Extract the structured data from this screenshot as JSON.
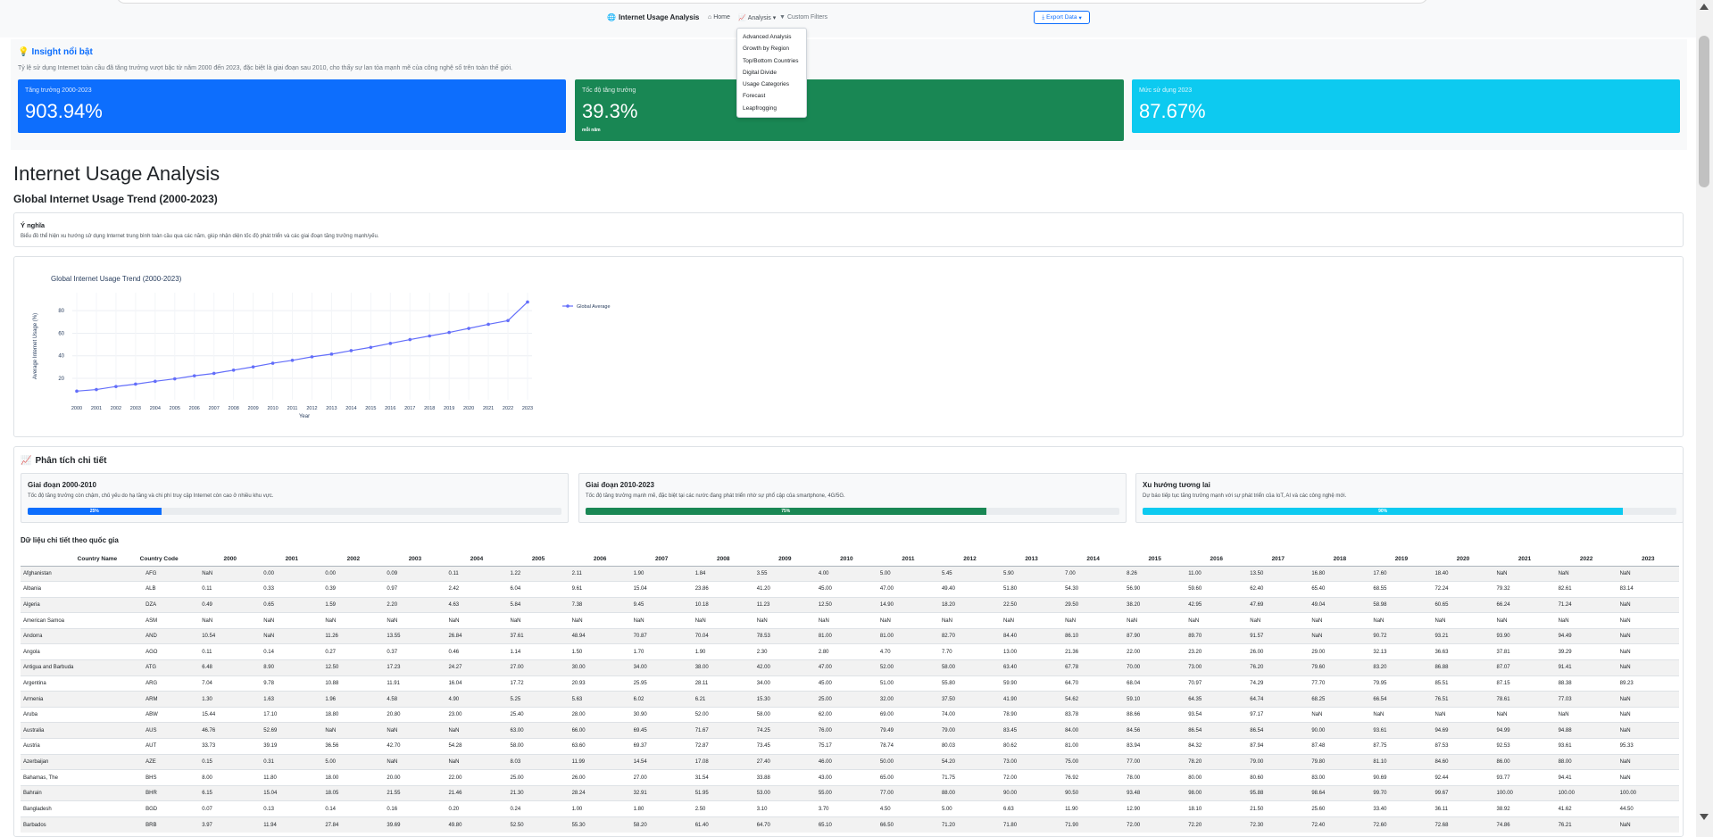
{
  "navbar": {
    "brand": "Internet Usage Analysis",
    "home": "Home",
    "analysis": "Analysis",
    "filters": "Custom Filters",
    "export": "Export Data",
    "dropdown": [
      "Advanced Analysis",
      "Growth by Region",
      "Top/Bottom Countries",
      "Digital Divide",
      "Usage Categories",
      "Forecast",
      "Leapfrogging"
    ]
  },
  "insight": {
    "title": "Insight nổi bật",
    "description": "Tỷ lệ sử dụng Internet toàn cầu đã tăng trưởng vượt bậc từ năm 2000 đến 2023, đặc biệt là giai đoạn sau 2010, cho thấy sự lan tỏa mạnh mẽ của công nghệ số trên toàn thế giới.",
    "cards": [
      {
        "label": "Tăng trưởng 2000-2023",
        "value": "903.94%",
        "sub": ""
      },
      {
        "label": "Tốc độ tăng trưởng",
        "value": "39.3%",
        "sub": "mỗi năm"
      },
      {
        "label": "Mức sử dụng 2023",
        "value": "87.67%",
        "sub": ""
      }
    ],
    "colors": {
      "blue": "#0d6efd",
      "green": "#198754",
      "cyan": "#0dcaf0"
    }
  },
  "main": {
    "title": "Internet Usage Analysis",
    "subtitle": "Global Internet Usage Trend (2000-2023)",
    "meaning_title": "Ý nghĩa",
    "meaning_text": "Biểu đồ thể hiện xu hướng sử dụng Internet trung bình toàn cầu qua các năm, giúp nhận diện tốc độ phát triển và các giai đoạn tăng trưởng mạnh/yếu."
  },
  "chart_data": {
    "type": "line",
    "title": "Global Internet Usage Trend (2000-2023)",
    "xlabel": "Year",
    "ylabel": "Average Internet Usage (%)",
    "x": [
      2000,
      2001,
      2002,
      2003,
      2004,
      2005,
      2006,
      2007,
      2008,
      2009,
      2010,
      2011,
      2012,
      2013,
      2014,
      2015,
      2016,
      2017,
      2018,
      2019,
      2020,
      2021,
      2022,
      2023
    ],
    "series": [
      {
        "name": "Global Average",
        "values": [
          8.7,
          10.1,
          12.8,
          14.9,
          17.4,
          19.6,
          22.3,
          24.4,
          27.3,
          30.2,
          33.4,
          36.0,
          39.1,
          41.5,
          44.6,
          47.5,
          51.0,
          54.4,
          57.6,
          60.7,
          64.3,
          67.9,
          71.2,
          87.67
        ],
        "color": "#636efa"
      }
    ],
    "yticks": [
      20,
      40,
      60,
      80
    ],
    "ylim": [
      5,
      92
    ],
    "legend": "top-right",
    "grid": true
  },
  "detail": {
    "title": "Phân tích chi tiết",
    "phases": [
      {
        "title": "Giai đoạn 2000-2010",
        "text": "Tốc độ tăng trưởng còn chậm, chủ yếu do hạ tầng và chi phí truy cập Internet còn cao ở nhiều khu vực.",
        "percent": 25,
        "label": "25%",
        "color": "#0d6efd"
      },
      {
        "title": "Giai đoạn 2010-2023",
        "text": "Tốc độ tăng trưởng mạnh mẽ, đặc biệt tại các nước đang phát triển nhờ sự phổ cập của smartphone, 4G/5G.",
        "percent": 75,
        "label": "75%",
        "color": "#198754"
      },
      {
        "title": "Xu hướng tương lai",
        "text": "Dự báo tiếp tục tăng trưởng mạnh với sự phát triển của IoT, AI và các công nghệ mới.",
        "percent": 90,
        "label": "90%",
        "color": "#0dcaf0"
      }
    ],
    "table_title": "Dữ liệu chi tiết theo quốc gia",
    "table": {
      "headers": [
        "Country Name",
        "Country Code",
        "2000",
        "2001",
        "2002",
        "2003",
        "2004",
        "2005",
        "2006",
        "2007",
        "2008",
        "2009",
        "2010",
        "2011",
        "2012",
        "2013",
        "2014",
        "2015",
        "2016",
        "2017",
        "2018",
        "2019",
        "2020",
        "2021",
        "2022",
        "2023"
      ],
      "rows": [
        [
          "Afghanistan",
          "AFG",
          "NaN",
          "0.00",
          "0.00",
          "0.09",
          "0.11",
          "1.22",
          "2.11",
          "1.90",
          "1.84",
          "3.55",
          "4.00",
          "5.00",
          "5.45",
          "5.90",
          "7.00",
          "8.26",
          "11.00",
          "13.50",
          "16.80",
          "17.60",
          "18.40",
          "NaN",
          "NaN",
          "NaN"
        ],
        [
          "Albania",
          "ALB",
          "0.11",
          "0.33",
          "0.39",
          "0.97",
          "2.42",
          "6.04",
          "9.61",
          "15.04",
          "23.86",
          "41.20",
          "45.00",
          "47.00",
          "49.40",
          "51.80",
          "54.30",
          "56.90",
          "59.60",
          "62.40",
          "65.40",
          "68.55",
          "72.24",
          "79.32",
          "82.61",
          "83.14"
        ],
        [
          "Algeria",
          "DZA",
          "0.49",
          "0.65",
          "1.59",
          "2.20",
          "4.63",
          "5.84",
          "7.38",
          "9.45",
          "10.18",
          "11.23",
          "12.50",
          "14.90",
          "18.20",
          "22.50",
          "29.50",
          "38.20",
          "42.95",
          "47.69",
          "49.04",
          "58.98",
          "60.65",
          "66.24",
          "71.24",
          "NaN"
        ],
        [
          "American Samoa",
          "ASM",
          "NaN",
          "NaN",
          "NaN",
          "NaN",
          "NaN",
          "NaN",
          "NaN",
          "NaN",
          "NaN",
          "NaN",
          "NaN",
          "NaN",
          "NaN",
          "NaN",
          "NaN",
          "NaN",
          "NaN",
          "NaN",
          "NaN",
          "NaN",
          "NaN",
          "NaN",
          "NaN",
          "NaN"
        ],
        [
          "Andorra",
          "AND",
          "10.54",
          "NaN",
          "11.26",
          "13.55",
          "26.84",
          "37.61",
          "48.94",
          "70.87",
          "70.04",
          "78.53",
          "81.00",
          "81.00",
          "82.70",
          "84.40",
          "86.10",
          "87.90",
          "89.70",
          "91.57",
          "NaN",
          "90.72",
          "93.21",
          "93.90",
          "94.49",
          "NaN"
        ],
        [
          "Angola",
          "AGO",
          "0.11",
          "0.14",
          "0.27",
          "0.37",
          "0.46",
          "1.14",
          "1.50",
          "1.70",
          "1.90",
          "2.30",
          "2.80",
          "4.70",
          "7.70",
          "13.00",
          "21.36",
          "22.00",
          "23.20",
          "26.00",
          "29.00",
          "32.13",
          "36.63",
          "37.81",
          "39.29",
          "NaN"
        ],
        [
          "Antigua and Barbuda",
          "ATG",
          "6.48",
          "8.90",
          "12.50",
          "17.23",
          "24.27",
          "27.00",
          "30.00",
          "34.00",
          "38.00",
          "42.00",
          "47.00",
          "52.00",
          "58.00",
          "63.40",
          "67.78",
          "70.00",
          "73.00",
          "76.20",
          "79.60",
          "83.20",
          "86.88",
          "87.07",
          "91.41",
          "NaN"
        ],
        [
          "Argentina",
          "ARG",
          "7.04",
          "9.78",
          "10.88",
          "11.91",
          "16.04",
          "17.72",
          "20.93",
          "25.95",
          "28.11",
          "34.00",
          "45.00",
          "51.00",
          "55.80",
          "59.90",
          "64.70",
          "68.04",
          "70.97",
          "74.29",
          "77.70",
          "79.95",
          "85.51",
          "87.15",
          "88.38",
          "89.23"
        ],
        [
          "Armenia",
          "ARM",
          "1.30",
          "1.63",
          "1.96",
          "4.58",
          "4.90",
          "5.25",
          "5.63",
          "6.02",
          "6.21",
          "15.30",
          "25.00",
          "32.00",
          "37.50",
          "41.90",
          "54.62",
          "59.10",
          "64.35",
          "64.74",
          "68.25",
          "66.54",
          "76.51",
          "78.61",
          "77.03",
          "NaN"
        ],
        [
          "Aruba",
          "ABW",
          "15.44",
          "17.10",
          "18.80",
          "20.80",
          "23.00",
          "25.40",
          "28.00",
          "30.90",
          "52.00",
          "58.00",
          "62.00",
          "69.00",
          "74.00",
          "78.90",
          "83.78",
          "88.66",
          "93.54",
          "97.17",
          "NaN",
          "NaN",
          "NaN",
          "NaN",
          "NaN",
          "NaN"
        ],
        [
          "Australia",
          "AUS",
          "46.76",
          "52.69",
          "NaN",
          "NaN",
          "NaN",
          "63.00",
          "66.00",
          "69.45",
          "71.67",
          "74.25",
          "76.00",
          "79.49",
          "79.00",
          "83.45",
          "84.00",
          "84.56",
          "86.54",
          "86.54",
          "90.00",
          "93.61",
          "94.69",
          "94.99",
          "94.88",
          "NaN"
        ],
        [
          "Austria",
          "AUT",
          "33.73",
          "39.19",
          "36.56",
          "42.70",
          "54.28",
          "58.00",
          "63.60",
          "69.37",
          "72.87",
          "73.45",
          "75.17",
          "78.74",
          "80.03",
          "80.62",
          "81.00",
          "83.94",
          "84.32",
          "87.94",
          "87.48",
          "87.75",
          "87.53",
          "92.53",
          "93.61",
          "95.33"
        ],
        [
          "Azerbaijan",
          "AZE",
          "0.15",
          "0.31",
          "5.00",
          "NaN",
          "NaN",
          "8.03",
          "11.99",
          "14.54",
          "17.08",
          "27.40",
          "46.00",
          "50.00",
          "54.20",
          "73.00",
          "75.00",
          "77.00",
          "78.20",
          "79.00",
          "79.80",
          "81.10",
          "84.60",
          "86.00",
          "88.00",
          "NaN"
        ],
        [
          "Bahamas, The",
          "BHS",
          "8.00",
          "11.80",
          "18.00",
          "20.00",
          "22.00",
          "25.00",
          "26.00",
          "27.00",
          "31.54",
          "33.88",
          "43.00",
          "65.00",
          "71.75",
          "72.00",
          "76.92",
          "78.00",
          "80.00",
          "80.60",
          "83.00",
          "90.69",
          "92.44",
          "93.77",
          "94.41",
          "NaN"
        ],
        [
          "Bahrain",
          "BHR",
          "6.15",
          "15.04",
          "18.05",
          "21.55",
          "21.46",
          "21.30",
          "28.24",
          "32.91",
          "51.95",
          "53.00",
          "55.00",
          "77.00",
          "88.00",
          "90.00",
          "90.50",
          "93.48",
          "98.00",
          "95.88",
          "98.64",
          "99.70",
          "99.67",
          "100.00",
          "100.00",
          "100.00"
        ],
        [
          "Bangladesh",
          "BGD",
          "0.07",
          "0.13",
          "0.14",
          "0.16",
          "0.20",
          "0.24",
          "1.00",
          "1.80",
          "2.50",
          "3.10",
          "3.70",
          "4.50",
          "5.00",
          "6.63",
          "11.90",
          "12.90",
          "18.10",
          "21.50",
          "25.60",
          "33.40",
          "36.11",
          "38.92",
          "41.62",
          "44.50"
        ],
        [
          "Barbados",
          "BRB",
          "3.97",
          "11.94",
          "27.84",
          "39.69",
          "49.80",
          "52.50",
          "55.30",
          "58.20",
          "61.40",
          "64.70",
          "65.10",
          "66.50",
          "71.20",
          "71.80",
          "71.90",
          "72.00",
          "72.20",
          "72.30",
          "72.40",
          "72.60",
          "72.68",
          "74.86",
          "76.21",
          "NaN"
        ]
      ]
    }
  }
}
